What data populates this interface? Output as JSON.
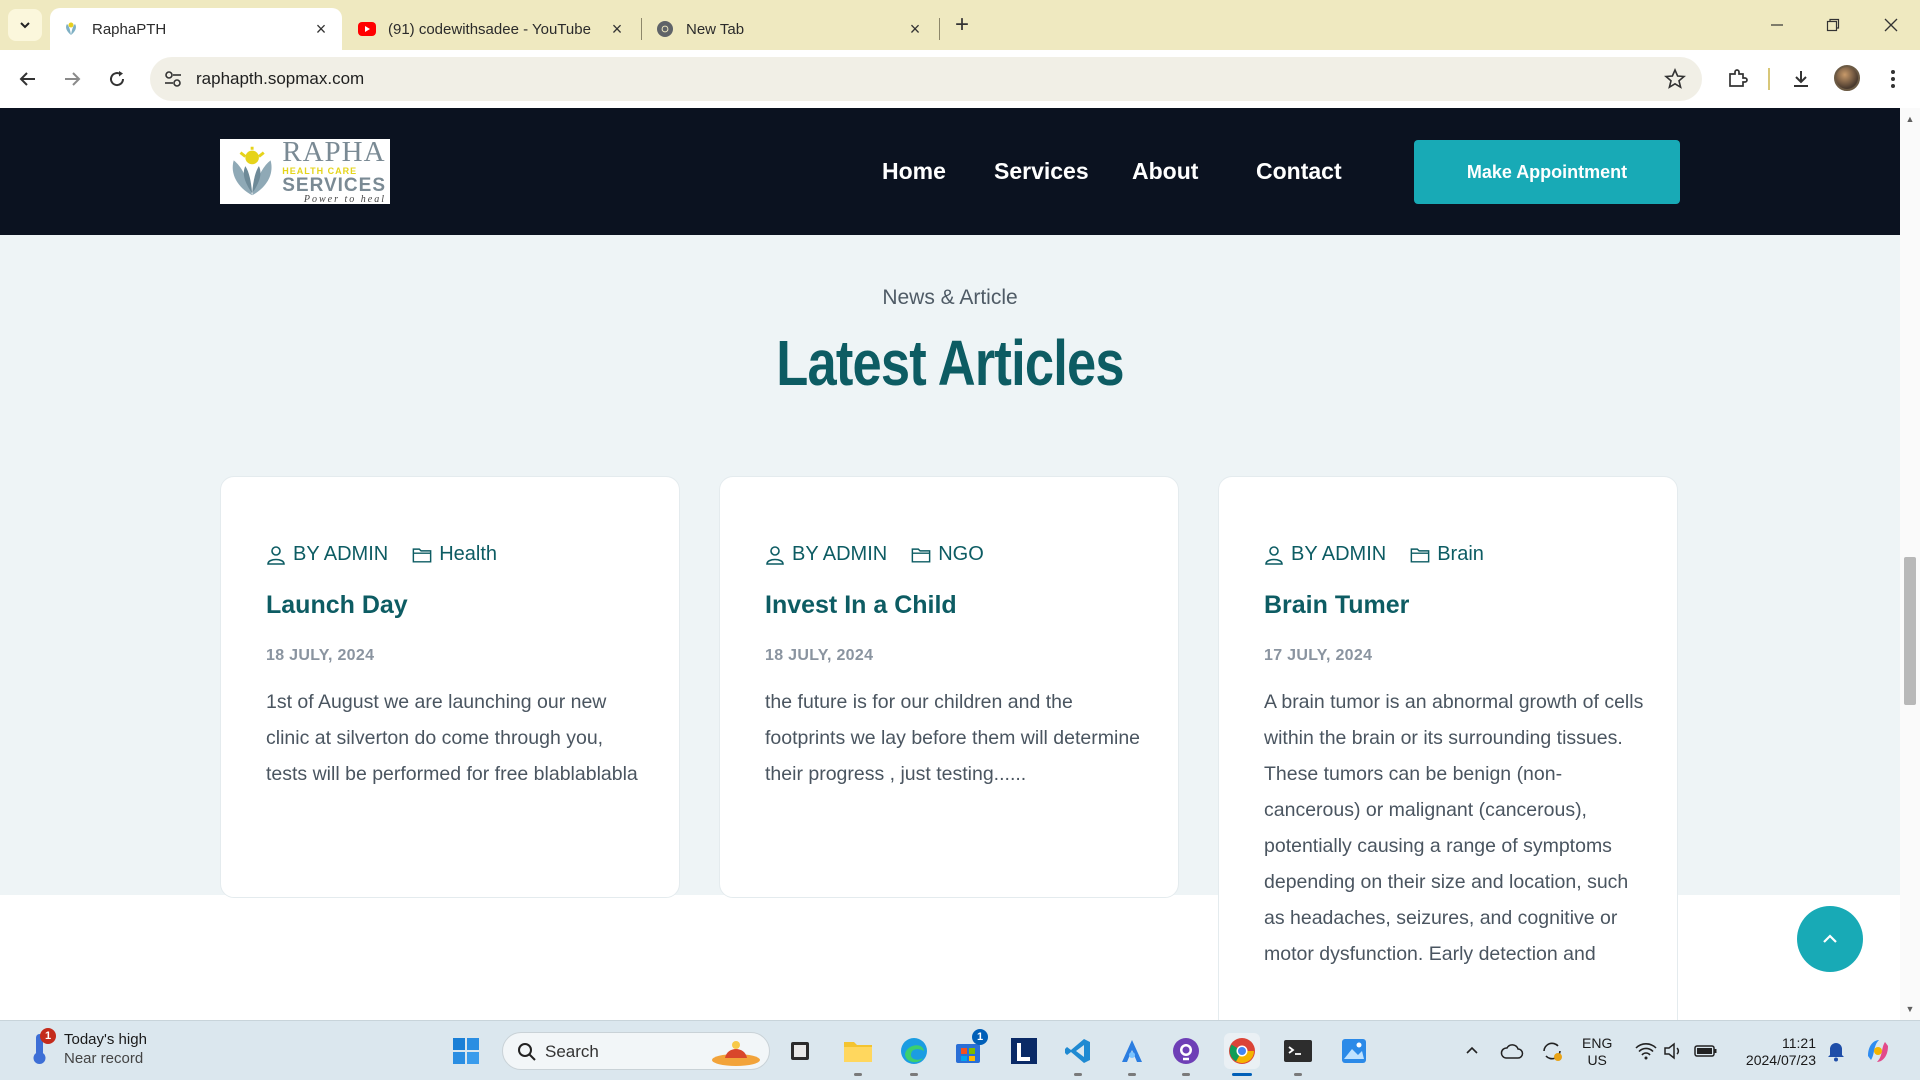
{
  "browser": {
    "tabs": [
      {
        "title": "RaphaPTH",
        "active": true,
        "icon": "rapha-favicon"
      },
      {
        "title": "(91) codewithsadee - YouTube",
        "active": false,
        "icon": "youtube-icon"
      },
      {
        "title": "New Tab",
        "active": false,
        "icon": "chrome-icon"
      }
    ],
    "url": "raphapth.sopmax.com"
  },
  "site": {
    "logo": {
      "line1": "RAPHA",
      "line2": "HEALTH CARE",
      "line3": "SERVICES",
      "tagline": "Power to heal"
    },
    "nav": [
      "Home",
      "Services",
      "About",
      "Contact"
    ],
    "cta": "Make Appointment"
  },
  "articles_section": {
    "kicker": "News & Article",
    "title": "Latest Articles",
    "cards": [
      {
        "author": "BY ADMIN",
        "category": "Health",
        "title": "Launch Day",
        "date": "18 JULY, 2024",
        "text": "1st of August we are launching our new clinic at silverton do come through you, tests will be performed for free blablablabla"
      },
      {
        "author": "BY ADMIN",
        "category": "NGO",
        "title": "Invest In a Child",
        "date": "18 JULY, 2024",
        "text": "the future is for our children and the footprints we lay before them will determine their progress , just testing......"
      },
      {
        "author": "BY ADMIN",
        "category": "Brain",
        "title": "Brain Tumer",
        "date": "17 JULY, 2024",
        "text": "A brain tumor is an abnormal growth of cells within the brain or its surrounding tissues. These tumors can be benign (non-cancerous) or malignant (cancerous), potentially causing a range of symptoms depending on their size and location, such as headaches, seizures, and cognitive or motor dysfunction. Early detection and"
      }
    ]
  },
  "taskbar": {
    "weather": {
      "title": "Today's high",
      "subtitle": "Near record",
      "badge": "1"
    },
    "search_placeholder": "Search",
    "store_badge": "1",
    "lang": {
      "line1": "ENG",
      "line2": "US"
    },
    "time": "11:21",
    "date": "2024/07/23"
  },
  "colors": {
    "accent": "#18aab6",
    "heading": "#0d5c63",
    "header_bg": "#0b1220",
    "tabstrip": "#efe9c0"
  }
}
